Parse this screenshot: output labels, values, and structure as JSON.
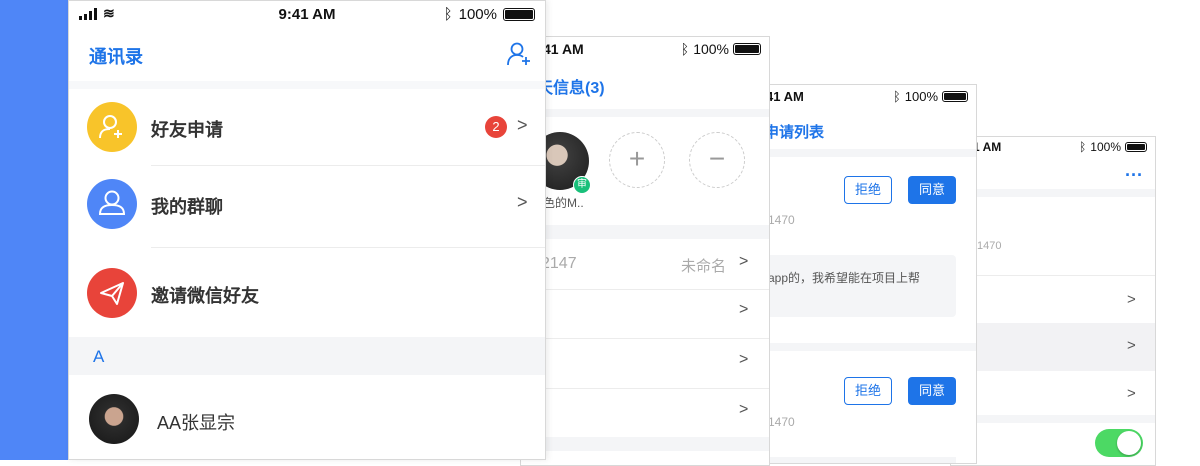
{
  "colors": {
    "accent": "#1e74e8",
    "side_strip": "#4f86f7",
    "badge": "#e8443a",
    "yellow": "#f8c42a",
    "blue": "#4f86f7",
    "red": "#e8443a",
    "green": "#4cd964"
  },
  "status": {
    "time": "9:41 AM",
    "time_short": "41 AM",
    "time_short2": "1 AM",
    "battery": "100%"
  },
  "screen1": {
    "title": "通讯录",
    "items": [
      {
        "label": "好友申请",
        "badge": "2"
      },
      {
        "label": "我的群聊"
      },
      {
        "label": "邀请微信好友"
      }
    ],
    "section": "A",
    "contact": {
      "name": "AA张显宗"
    }
  },
  "screen2": {
    "title": "天信息(3)",
    "member_name": "色的M..",
    "member_badge": "审",
    "id_value": "2147",
    "remark": "未命名"
  },
  "screen3": {
    "title": "申请列表",
    "reject": "拒绝",
    "accept": "同意",
    "number": "1470",
    "message": "app的，我希望能在项目上帮"
  },
  "screen4": {
    "more": "···",
    "number": "1470"
  }
}
